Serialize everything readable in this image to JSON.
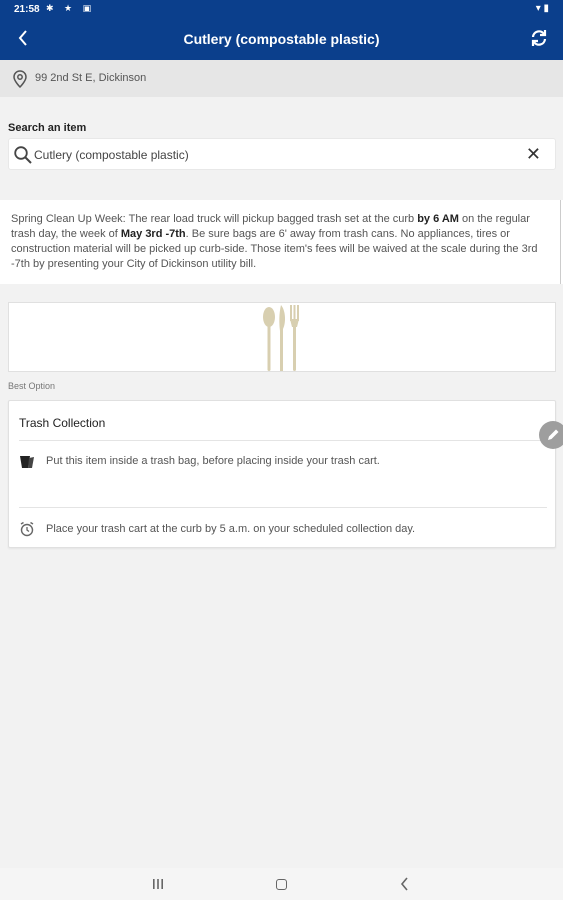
{
  "status_bar": {
    "time": "21:58",
    "indicators": "✱ ★ ▣",
    "right_icons": "▾ ▮"
  },
  "header": {
    "title": "Cutlery (compostable plastic)",
    "back_icon": "chevron-left-icon",
    "refresh_icon": "refresh-icon"
  },
  "location": {
    "address": "99 2nd St E, Dickinson",
    "icon": "location-pin-icon"
  },
  "search": {
    "label": "Search an item",
    "value": "Cutlery (compostable plastic)",
    "clear_symbol": "✕"
  },
  "notice": {
    "part1": "Spring Clean Up Week: The rear load truck will pickup bagged trash set at the curb ",
    "bold1": "by 6 AM",
    "part2": " on the regular trash day, the week of ",
    "bold2": "May 3rd -7th",
    "part3": ". Be sure bags are 6' away from trash cans. No appliances, tires or construction material will be picked up curb-side. Those item's fees will be waived at the scale during the 3rd -7th by presenting your City of Dickinson utility bill."
  },
  "item_image": {
    "icon": "cutlery-icon",
    "color": "#d8cfb0"
  },
  "best_option": {
    "label": "Best Option",
    "title": "Trash Collection",
    "instructions": [
      {
        "icon": "trash-bag-icon",
        "text": "Put this item inside a trash bag, before placing inside your trash cart."
      },
      {
        "icon": "alarm-clock-icon",
        "text": "Place your trash cart at the curb by 5 a.m. on your scheduled collection day."
      }
    ]
  },
  "colors": {
    "primary": "#0b3f8c",
    "background": "#f2f2f2"
  }
}
